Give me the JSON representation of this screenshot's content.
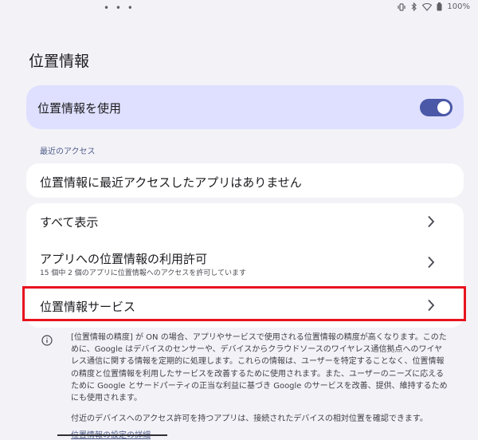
{
  "status_bar": {
    "dots": "• • •",
    "battery": "100%"
  },
  "page": {
    "title": "位置情報"
  },
  "master_toggle": {
    "label": "位置情報を使用",
    "state": "on"
  },
  "recent_access": {
    "header": "最近のアクセス",
    "empty_text": "位置情報に最近アクセスしたアプリはありません"
  },
  "list": {
    "see_all": "すべて表示",
    "app_permission_title": "アプリへの位置情報の利用許可",
    "app_permission_sub": "15 個中 2 個のアプリに位置情報へのアクセスを許可しています",
    "location_services": "位置情報サービス"
  },
  "footer": {
    "body": "[位置情報の精度] が ON の場合、アプリやサービスで使用される位置情報の精度が高くなります。このために、Google はデバイスのセンサーや、デバイスからクラウドソースのワイヤレス通信拠点へのワイヤレス通信に関する情報を定期的に処理します。これらの情報は、ユーザーを特定することなく、位置情報の精度と位置情報を利用したサービスを改善するために使用されます。また、ユーザーのニーズに応えるために Google とサードパーティの正当な利益に基づき Google のサービスを改善、提供、維持するためにも使用されます。",
    "nearby": "付近のデバイスへのアクセス許可を持つアプリは、接続されたデバイスの相対位置を確認できます。",
    "link": "位置情報の設定の詳細"
  },
  "icons": {
    "vibrate": "vibrate-icon",
    "bluetooth": "bluetooth-icon",
    "wifi": "wifi-icon",
    "battery": "battery-icon",
    "chevron": "chevron-right-icon",
    "info": "info-icon"
  },
  "colors": {
    "background": "#f3f2f7",
    "master_card": "#dfe0ff",
    "toggle_track": "#4b58a8",
    "highlight": "#e8141f",
    "accent_text": "#4e5d8a"
  }
}
